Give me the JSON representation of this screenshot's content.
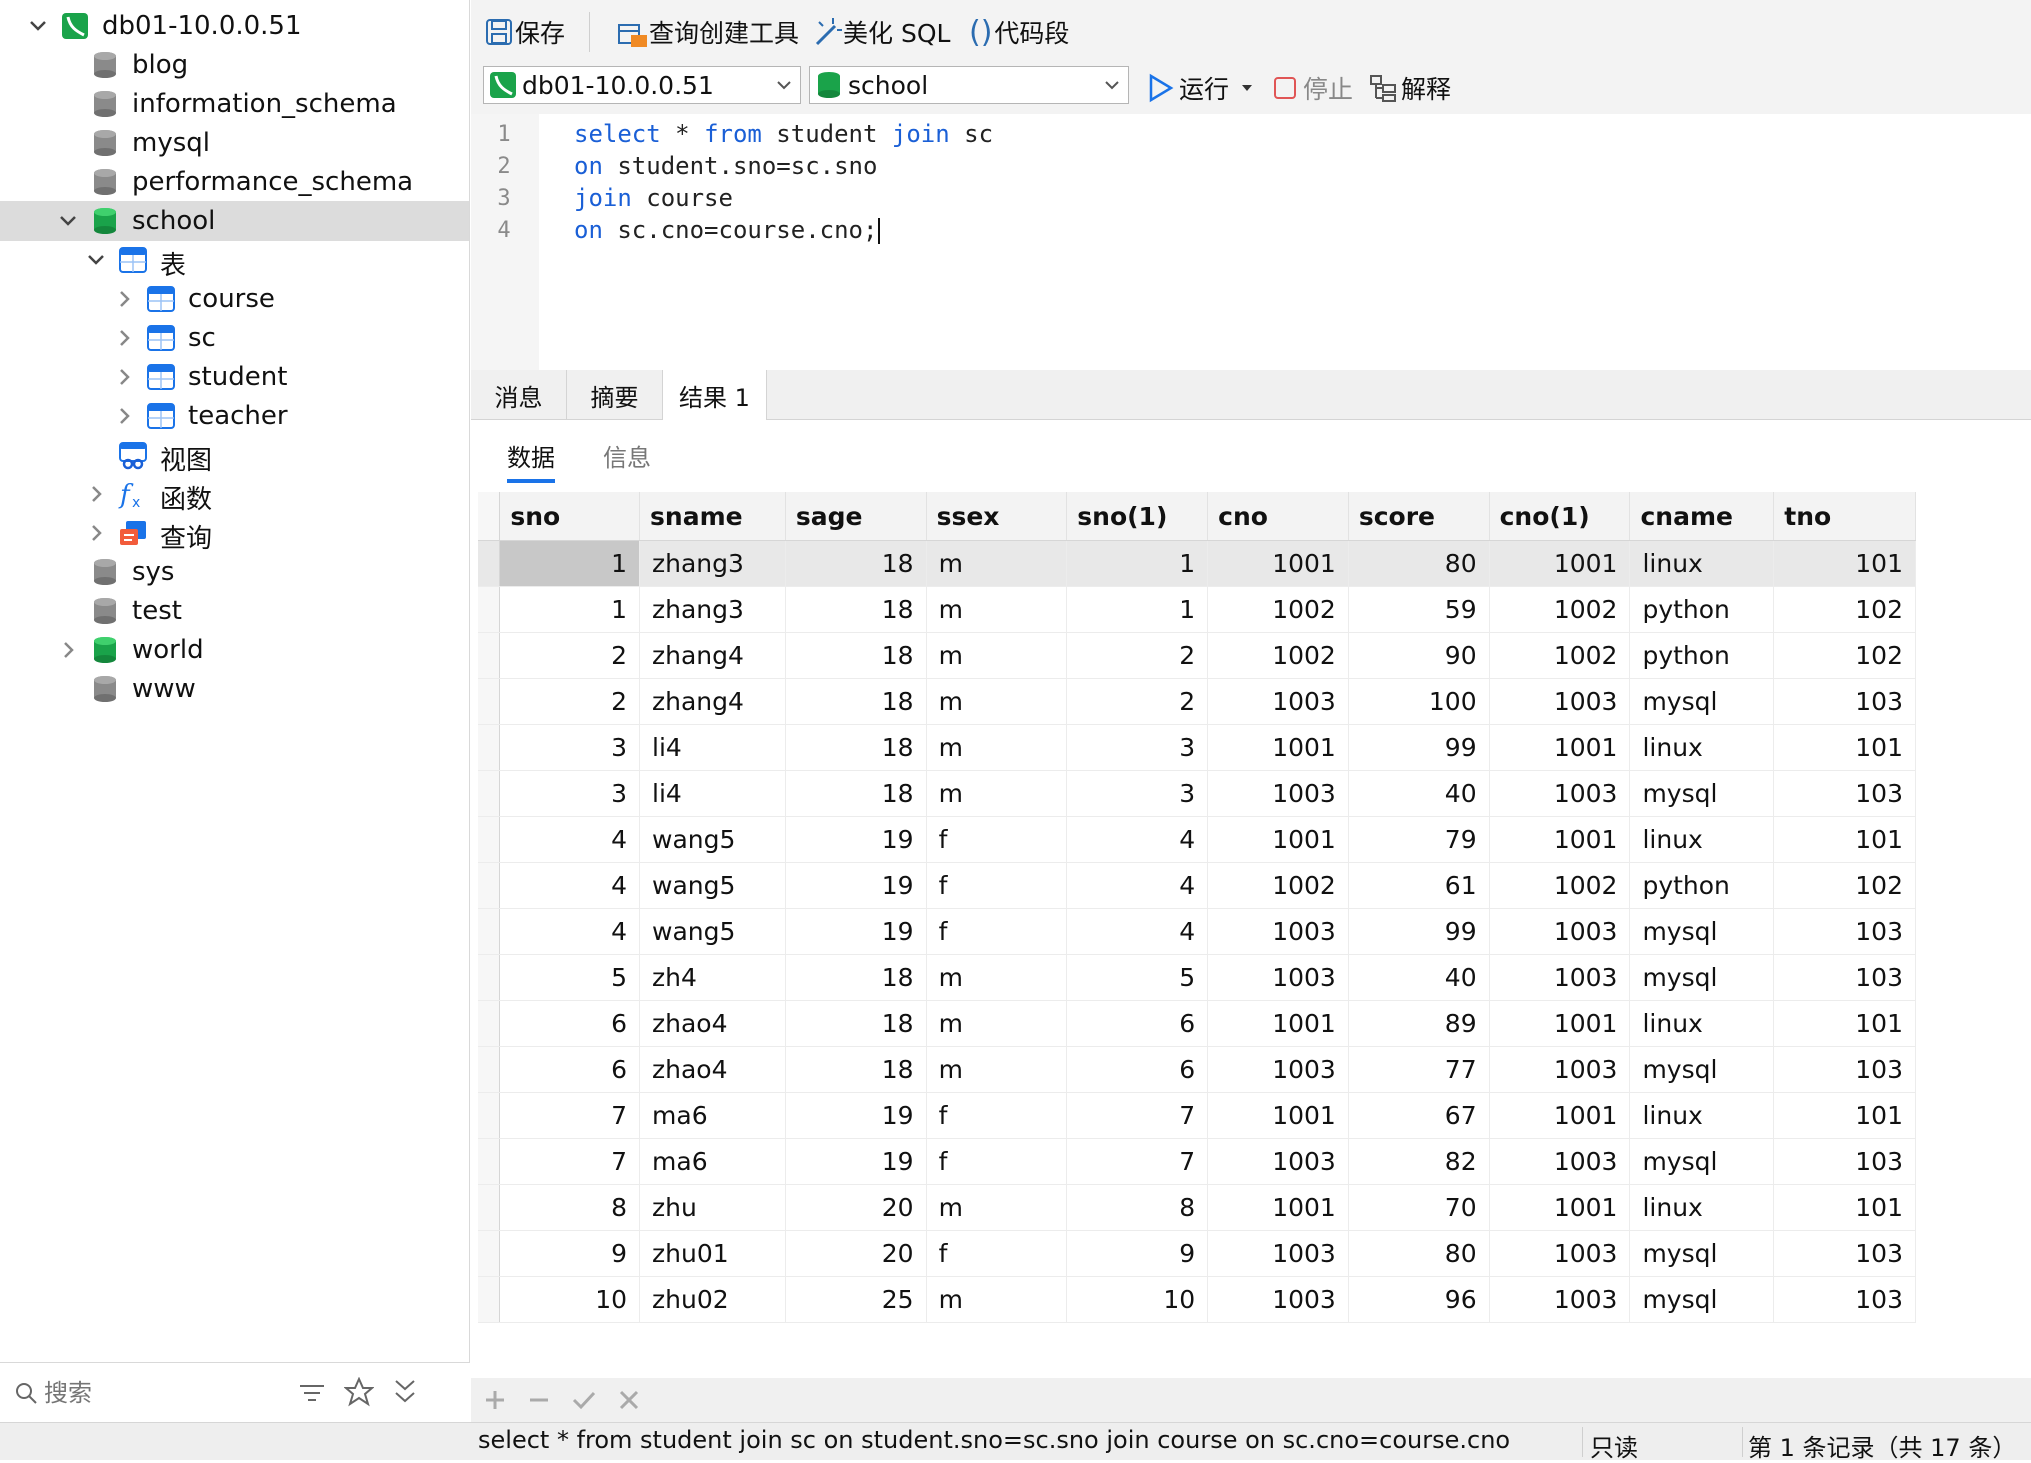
{
  "sidebar": {
    "items": [
      {
        "label": "db01-10.0.0.51",
        "level": 0,
        "chevron": "down",
        "icon": "connection-icon",
        "selected": false
      },
      {
        "label": "blog",
        "level": 1,
        "chevron": "",
        "icon": "database-gray-icon",
        "selected": false
      },
      {
        "label": "information_schema",
        "level": 1,
        "chevron": "",
        "icon": "database-gray-icon",
        "selected": false
      },
      {
        "label": "mysql",
        "level": 1,
        "chevron": "",
        "icon": "database-gray-icon",
        "selected": false
      },
      {
        "label": "performance_schema",
        "level": 1,
        "chevron": "",
        "icon": "database-gray-icon",
        "selected": false
      },
      {
        "label": "school",
        "level": 1,
        "chevron": "down",
        "icon": "database-green-icon",
        "selected": true
      },
      {
        "label": "表",
        "level": 2,
        "chevron": "down",
        "icon": "table-group-icon",
        "selected": false
      },
      {
        "label": "course",
        "level": 3,
        "chevron": "right",
        "icon": "table-icon",
        "selected": false
      },
      {
        "label": "sc",
        "level": 3,
        "chevron": "right",
        "icon": "table-icon",
        "selected": false
      },
      {
        "label": "student",
        "level": 3,
        "chevron": "right",
        "icon": "table-icon",
        "selected": false
      },
      {
        "label": "teacher",
        "level": 3,
        "chevron": "right",
        "icon": "table-icon",
        "selected": false
      },
      {
        "label": "视图",
        "level": 2,
        "chevron": "",
        "icon": "view-icon",
        "selected": false
      },
      {
        "label": "函数",
        "level": 2,
        "chevron": "right",
        "icon": "function-icon",
        "selected": false
      },
      {
        "label": "查询",
        "level": 2,
        "chevron": "right",
        "icon": "query-icon",
        "selected": false
      },
      {
        "label": "sys",
        "level": 1,
        "chevron": "",
        "icon": "database-gray-icon",
        "selected": false
      },
      {
        "label": "test",
        "level": 1,
        "chevron": "",
        "icon": "database-gray-icon",
        "selected": false
      },
      {
        "label": "world",
        "level": 1,
        "chevron": "right",
        "icon": "database-green-icon",
        "selected": false
      },
      {
        "label": "www",
        "level": 1,
        "chevron": "",
        "icon": "database-gray-icon",
        "selected": false
      }
    ],
    "search_placeholder": "搜索"
  },
  "toolbar": {
    "save": "保存",
    "query_builder": "查询创建工具",
    "beautify": "美化 SQL",
    "snippet": "代码段",
    "connection": "db01-10.0.0.51",
    "database": "school",
    "run": "运行",
    "stop": "停止",
    "explain": "解释"
  },
  "editor": {
    "lines": [
      [
        {
          "t": "select",
          "k": true
        },
        {
          "t": " * ",
          "k": false
        },
        {
          "t": "from",
          "k": true
        },
        {
          "t": " student ",
          "k": false
        },
        {
          "t": "join",
          "k": true
        },
        {
          "t": " sc",
          "k": false
        }
      ],
      [
        {
          "t": "on",
          "k": true
        },
        {
          "t": " student.sno=sc.sno",
          "k": false
        }
      ],
      [
        {
          "t": "join",
          "k": true
        },
        {
          "t": " course",
          "k": false
        }
      ],
      [
        {
          "t": "on",
          "k": true
        },
        {
          "t": " sc.cno=course.cno;",
          "k": false
        }
      ]
    ],
    "line_numbers": [
      "1",
      "2",
      "3",
      "4"
    ]
  },
  "result_tabs": [
    "消息",
    "摘要",
    "结果 1"
  ],
  "sub_tabs": [
    "数据",
    "信息"
  ],
  "grid": {
    "columns": [
      "sno",
      "sname",
      "sage",
      "ssex",
      "sno(1)",
      "cno",
      "score",
      "cno(1)",
      "cname",
      "tno"
    ],
    "numeric": [
      true,
      false,
      true,
      false,
      true,
      true,
      true,
      true,
      false,
      true
    ],
    "rows": [
      [
        "1",
        "zhang3",
        "18",
        "m",
        "1",
        "1001",
        "80",
        "1001",
        "linux",
        "101"
      ],
      [
        "1",
        "zhang3",
        "18",
        "m",
        "1",
        "1002",
        "59",
        "1002",
        "python",
        "102"
      ],
      [
        "2",
        "zhang4",
        "18",
        "m",
        "2",
        "1002",
        "90",
        "1002",
        "python",
        "102"
      ],
      [
        "2",
        "zhang4",
        "18",
        "m",
        "2",
        "1003",
        "100",
        "1003",
        "mysql",
        "103"
      ],
      [
        "3",
        "li4",
        "18",
        "m",
        "3",
        "1001",
        "99",
        "1001",
        "linux",
        "101"
      ],
      [
        "3",
        "li4",
        "18",
        "m",
        "3",
        "1003",
        "40",
        "1003",
        "mysql",
        "103"
      ],
      [
        "4",
        "wang5",
        "19",
        "f",
        "4",
        "1001",
        "79",
        "1001",
        "linux",
        "101"
      ],
      [
        "4",
        "wang5",
        "19",
        "f",
        "4",
        "1002",
        "61",
        "1002",
        "python",
        "102"
      ],
      [
        "4",
        "wang5",
        "19",
        "f",
        "4",
        "1003",
        "99",
        "1003",
        "mysql",
        "103"
      ],
      [
        "5",
        "zh4",
        "18",
        "m",
        "5",
        "1003",
        "40",
        "1003",
        "mysql",
        "103"
      ],
      [
        "6",
        "zhao4",
        "18",
        "m",
        "6",
        "1001",
        "89",
        "1001",
        "linux",
        "101"
      ],
      [
        "6",
        "zhao4",
        "18",
        "m",
        "6",
        "1003",
        "77",
        "1003",
        "mysql",
        "103"
      ],
      [
        "7",
        "ma6",
        "19",
        "f",
        "7",
        "1001",
        "67",
        "1001",
        "linux",
        "101"
      ],
      [
        "7",
        "ma6",
        "19",
        "f",
        "7",
        "1003",
        "82",
        "1003",
        "mysql",
        "103"
      ],
      [
        "8",
        "zhu",
        "20",
        "m",
        "8",
        "1001",
        "70",
        "1001",
        "linux",
        "101"
      ],
      [
        "9",
        "zhu01",
        "20",
        "f",
        "9",
        "1003",
        "80",
        "1003",
        "mysql",
        "103"
      ],
      [
        "10",
        "zhu02",
        "25",
        "m",
        "10",
        "1003",
        "96",
        "1003",
        "mysql",
        "103"
      ]
    ]
  },
  "status": {
    "sql": "select * from student join sc on student.sno=sc.sno join course on sc.cno=course.cno",
    "mode": "只读",
    "record": "第 1 条记录（共 17 条）"
  },
  "colors": {
    "accent": "#1a73e8",
    "keyword": "#1a5fd6",
    "green_db": "#1aa34a",
    "selection": "#dcdcdc"
  }
}
